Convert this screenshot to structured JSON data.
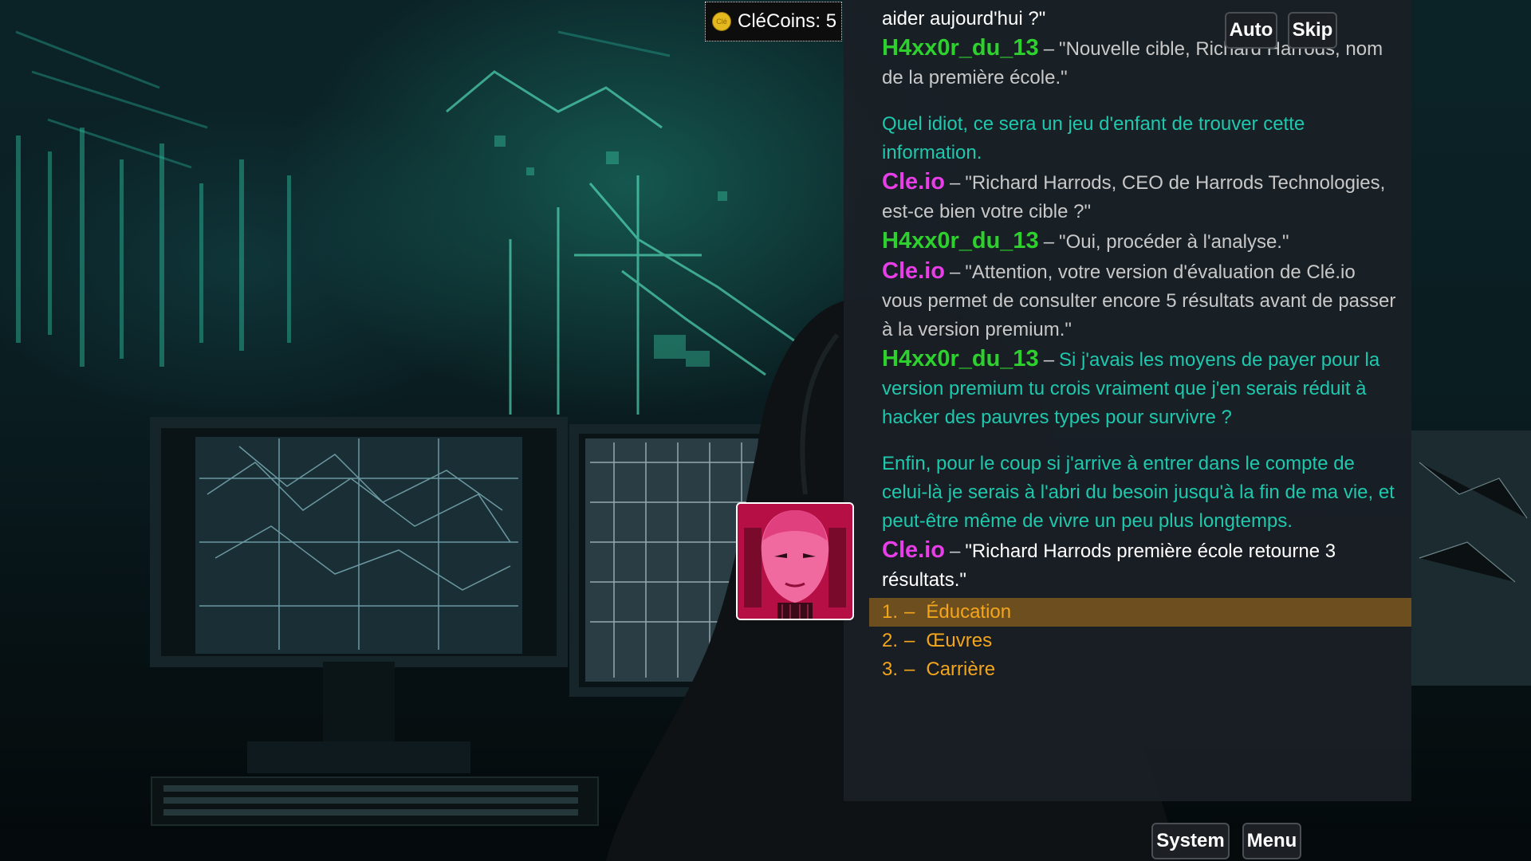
{
  "hud": {
    "coins_label": "CléCoins: 5",
    "coin_icon_glyph": "Clé"
  },
  "controls": {
    "auto_label": "Auto",
    "skip_label": "Skip",
    "system_label": "System",
    "menu_label": "Menu"
  },
  "dialogue": [
    {
      "speaker": "",
      "text": "aider aujourd'hui ?\"",
      "style": "white"
    },
    {
      "speaker": "H4xx0r_du_13",
      "speaker_type": "hacker",
      "text": "\"Nouvelle cible, Richard Harrods, nom de la première école.\"",
      "style": "speech"
    },
    {
      "speaker": "",
      "text": "Quel idiot, ce sera un jeu d'enfant de trouver cette information.",
      "style": "thought"
    },
    {
      "speaker": "Cle.io",
      "speaker_type": "ai",
      "text": "\"Richard Harrods, CEO de Harrods Technologies, est-ce bien votre cible ?\"",
      "style": "speech"
    },
    {
      "speaker": "H4xx0r_du_13",
      "speaker_type": "hacker",
      "text": "\"Oui, procéder à l'analyse.\"",
      "style": "speech"
    },
    {
      "speaker": "Cle.io",
      "speaker_type": "ai",
      "text": "\"Attention, votre version d'évaluation de Clé.io vous permet de consulter encore 5 résultats avant de passer à la version premium.\"",
      "style": "speech"
    },
    {
      "speaker": "H4xx0r_du_13",
      "speaker_type": "hacker",
      "text": "Si j'avais les moyens de payer pour la version premium tu crois vraiment que j'en serais réduit à hacker des pauvres types pour survivre ?",
      "style": "thought"
    },
    {
      "speaker": "",
      "text": "Enfin, pour le coup si j'arrive à entrer dans le compte de celui-là je serais à l'abri du besoin jusqu'à la fin de ma vie, et peut-être même de vivre un peu plus longtemps.",
      "style": "thought"
    },
    {
      "speaker": "Cle.io",
      "speaker_type": "ai",
      "text": "\"Richard Harrods première école retourne 3 résultats.\"",
      "style": "white"
    }
  ],
  "choices": [
    {
      "num": "1.",
      "label": "Éducation",
      "selected": true
    },
    {
      "num": "2.",
      "label": "Œuvres",
      "selected": false
    },
    {
      "num": "3.",
      "label": "Carrière",
      "selected": false
    }
  ],
  "dash": "–",
  "colors": {
    "hacker": "#2ed02e",
    "ai": "#e83ee8",
    "thought": "#1fc8ad",
    "choice": "#f3a51c",
    "selected_bg": "#6d4f1f"
  },
  "portrait_icon": "robot-woman-portrait"
}
